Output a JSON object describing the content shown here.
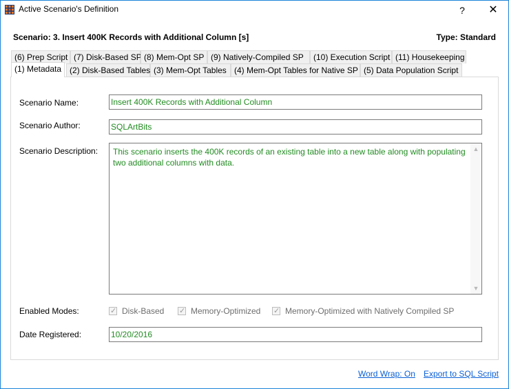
{
  "window": {
    "title": "Active Scenario's Definition",
    "help_glyph": "?",
    "close_glyph": "✕"
  },
  "header": {
    "scenario": "Scenario: 3. Insert 400K Records with Additional Column [s]",
    "type": "Type: Standard"
  },
  "tabs_row1": [
    {
      "label": "(6) Prep Script"
    },
    {
      "label": "(7) Disk-Based SP"
    },
    {
      "label": "(8) Mem-Opt SP"
    },
    {
      "label": "(9) Natively-Compiled SP"
    },
    {
      "label": "(10) Execution Script"
    },
    {
      "label": "(11) Housekeeping"
    }
  ],
  "tabs_row2": [
    {
      "label": "(1) Metadata",
      "active": true
    },
    {
      "label": "(2) Disk-Based Tables"
    },
    {
      "label": "(3) Mem-Opt Tables"
    },
    {
      "label": "(4) Mem-Opt Tables for Native SP"
    },
    {
      "label": "(5) Data Population Script"
    }
  ],
  "metadata": {
    "name_label": "Scenario Name:",
    "name_value": "Insert 400K Records with Additional Column",
    "author_label": "Scenario Author:",
    "author_value": "SQLArtBits",
    "description_label": "Scenario Description:",
    "description_value": "This scenario inserts the 400K records of an existing table into a new table along with populating two additional columns with data.",
    "modes_label": "Enabled Modes:",
    "modes": [
      {
        "label": "Disk-Based",
        "checked": true
      },
      {
        "label": "Memory-Optimized",
        "checked": true
      },
      {
        "label": "Memory-Optimized with Natively Compiled SP",
        "checked": true
      }
    ],
    "date_label": "Date Registered:",
    "date_value": "10/20/2016"
  },
  "footer": {
    "word_wrap": "Word Wrap: On",
    "export": "Export to SQL Script"
  },
  "colors": {
    "value_text": "#228b22",
    "link": "#0a5fd6",
    "window_border": "#1883d7"
  }
}
